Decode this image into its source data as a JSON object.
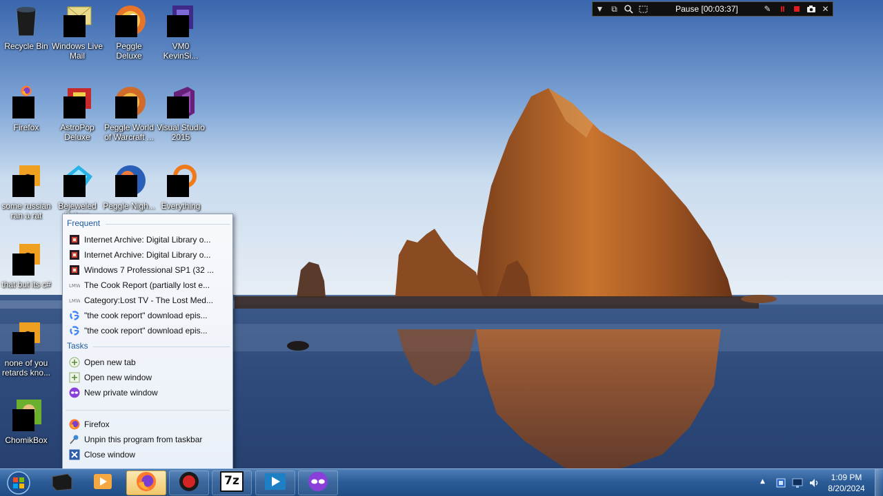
{
  "colors": {
    "accent": "#1e5aa0",
    "taskbar": "#2c5d98",
    "recorder_bg": "#101010",
    "record_red": "#e21b1b"
  },
  "desktop_icons": [
    {
      "label": "Recycle Bin",
      "icon": "recycle-bin-icon"
    },
    {
      "label": "Windows Live Mail",
      "icon": "windows-live-mail-icon"
    },
    {
      "label": "Peggle Deluxe",
      "icon": "peggle-deluxe-icon"
    },
    {
      "label": "VM0 KevinSi...",
      "icon": "vm-shortcut-icon"
    },
    {
      "label": "Firefox",
      "icon": "firefox-icon"
    },
    {
      "label": "AstroPop Deluxe",
      "icon": "astropop-icon"
    },
    {
      "label": "Peggle World of Warcraft ...",
      "icon": "peggle-wow-icon"
    },
    {
      "label": "Visual Studio 2015",
      "icon": "visual-studio-icon"
    },
    {
      "label": "some russian ran a rat",
      "icon": "shortcut-icon"
    },
    {
      "label": "Bejeweled Deluxe",
      "icon": "bejeweled-icon"
    },
    {
      "label": "Peggle Nigh...",
      "icon": "peggle-nights-icon"
    },
    {
      "label": "Everything",
      "icon": "everything-search-icon"
    },
    {
      "label": "that but its c#",
      "icon": "shortcut-icon"
    },
    {
      "label": "none of you retards kno...",
      "icon": "shortcut-icon"
    },
    {
      "label": "ChomikBox",
      "icon": "chomikbox-icon"
    }
  ],
  "recorder": {
    "status": "Pause [00:03:37]",
    "buttons": [
      "dropdown-icon",
      "restore-icon",
      "zoom-icon",
      "region-icon",
      "pen-icon",
      "record-icon",
      "stop-icon",
      "camera-icon",
      "close-icon"
    ]
  },
  "jumplist": {
    "frequent_header": "Frequent",
    "frequent": [
      {
        "label": "Internet Archive: Digital Library o...",
        "icon": "internet-archive-icon"
      },
      {
        "label": "Internet Archive: Digital Library o...",
        "icon": "internet-archive-icon"
      },
      {
        "label": "Windows 7 Professional SP1 (32 ...",
        "icon": "internet-archive-icon"
      },
      {
        "label": "The Cook Report (partially lost e...",
        "icon": "lost-media-wiki-icon"
      },
      {
        "label": "Category:Lost TV - The Lost Med...",
        "icon": "lost-media-wiki-icon"
      },
      {
        "label": "\"the cook report\" download epis...",
        "icon": "google-icon"
      },
      {
        "label": "\"the cook report\" download epis...",
        "icon": "google-icon"
      }
    ],
    "tasks_header": "Tasks",
    "tasks": [
      {
        "label": "Open new tab",
        "icon": "new-tab-icon"
      },
      {
        "label": "Open new window",
        "icon": "new-window-icon"
      },
      {
        "label": "New private window",
        "icon": "private-browsing-icon"
      }
    ],
    "footer": [
      {
        "label": "Firefox",
        "icon": "firefox-icon"
      },
      {
        "label": "Unpin this program from taskbar",
        "icon": "unpin-icon"
      },
      {
        "label": "Close window",
        "icon": "close-window-icon"
      }
    ]
  },
  "taskbar": {
    "start_icon": "windows-start-orb-icon",
    "apps": [
      {
        "icon": "black-box-app-icon"
      },
      {
        "icon": "media-player-icon"
      },
      {
        "icon": "firefox-icon"
      },
      {
        "icon": "recorder-app-icon"
      },
      {
        "icon": "7zip-icon",
        "text": "7z"
      },
      {
        "icon": "media-center-icon"
      },
      {
        "icon": "private-browsing-icon"
      }
    ],
    "tray_icons": [
      "show-hidden-icons-chevron",
      "network-icon",
      "display-icon",
      "volume-icon"
    ],
    "time": "1:09 PM",
    "date": "8/20/2024"
  }
}
